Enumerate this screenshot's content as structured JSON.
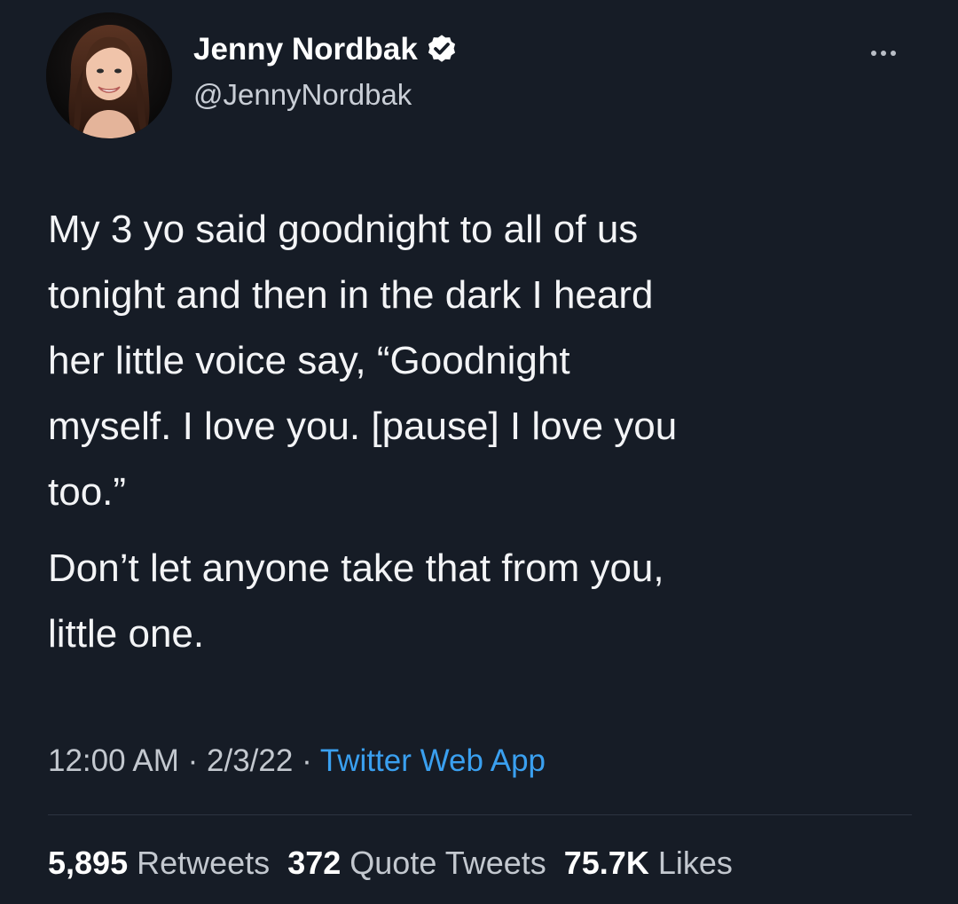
{
  "author": {
    "name": "Jenny Nordbak",
    "handle": "@JennyNordbak",
    "verified": true,
    "avatar_icon": "profile-photo"
  },
  "tweet": {
    "paragraphs": [
      "My 3 yo said goodnight to all of us\ntonight and then in the dark I heard\nher little voice say, “Goodnight\nmyself. I love you. [pause] I love you\ntoo.”",
      "Don’t let anyone take that from you,\nlittle one."
    ],
    "time": "12:00 AM",
    "separator": "·",
    "date": "2/3/22",
    "source": "Twitter Web App"
  },
  "stats": {
    "retweets_count": "5,895",
    "retweets_label": "Retweets",
    "quotes_count": "372",
    "quotes_label": "Quote Tweets",
    "likes_count": "75.7K",
    "likes_label": "Likes"
  },
  "colors": {
    "background": "#161c26",
    "text": "#f3f4f6",
    "secondary_text": "#c3c8cf",
    "link": "#3aa0f0"
  },
  "icons": {
    "verified": "verified-badge-icon",
    "more": "more-options-icon"
  }
}
